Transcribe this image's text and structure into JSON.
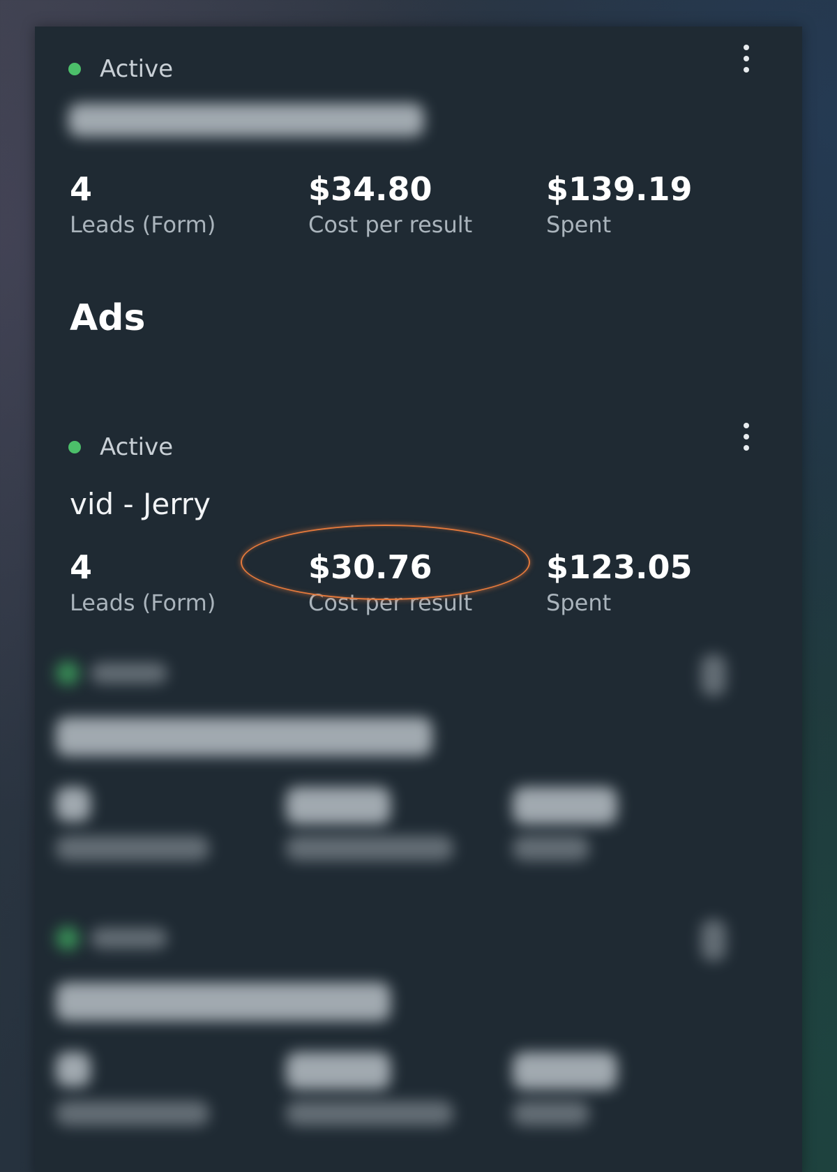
{
  "campaign": {
    "status": "Active",
    "metrics": [
      {
        "value": "4",
        "label": "Leads (Form)"
      },
      {
        "value": "$34.80",
        "label": "Cost per result"
      },
      {
        "value": "$139.19",
        "label": "Spent"
      }
    ]
  },
  "ads_section": {
    "title": "Ads"
  },
  "ads": [
    {
      "status": "Active",
      "name": "vid - Jerry",
      "metrics": [
        {
          "value": "4",
          "label": "Leads (Form)"
        },
        {
          "value": "$30.76",
          "label": "Cost per result"
        },
        {
          "value": "$123.05",
          "label": "Spent"
        }
      ]
    }
  ],
  "colors": {
    "panel": "#1f2a33",
    "active_dot": "#4cbf6a",
    "highlight": "#e67a3c"
  },
  "icons": {
    "more": "kebab-menu-icon"
  }
}
